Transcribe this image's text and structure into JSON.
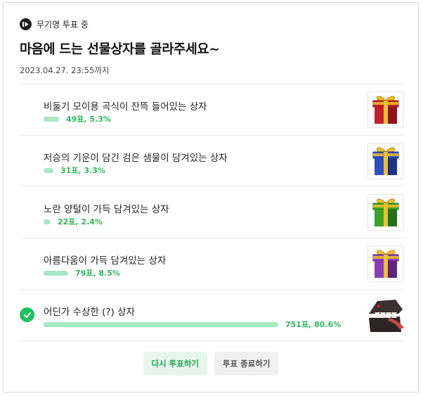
{
  "status": {
    "label": "무기명 투표 중"
  },
  "title": "마음에 드는 선물상자를 골라주세요~",
  "deadline": "2023.04.27. 23:55까지",
  "options": [
    {
      "label": "비둘기 모이용 곡식이 잔뜩 들어있는 상자",
      "result": "49표, 5.3%",
      "percent": 5.3,
      "selected": false,
      "image": "red-gift-box",
      "box_color": "#c4202a",
      "box_dark": "#8f1219"
    },
    {
      "label": "저승의 기운이 담긴 검은 샘물이 담겨있는 상자",
      "result": "31표, 3.3%",
      "percent": 3.3,
      "selected": false,
      "image": "blue-gift-box",
      "box_color": "#2f4fbf",
      "box_dark": "#1d328a"
    },
    {
      "label": "노란 양털이 가득 담겨있는 상자",
      "result": "22표, 2.4%",
      "percent": 2.4,
      "selected": false,
      "image": "green-gift-box",
      "box_color": "#3aa32a",
      "box_dark": "#23701a"
    },
    {
      "label": "아름다움이 가득 담겨있는 상자",
      "result": "79표, 8.5%",
      "percent": 8.5,
      "selected": false,
      "image": "purple-gift-box",
      "box_color": "#8a3fb8",
      "box_dark": "#5e2383"
    },
    {
      "label": "어딘가 수상한 (?) 상자",
      "result": "751표, 80.6%",
      "percent": 80.6,
      "selected": true,
      "image": "mimic-chest-monster"
    }
  ],
  "buttons": {
    "revote": "다시 투표하기",
    "end": "투표 종료하기"
  },
  "colors": {
    "bar": "#a6e8c4",
    "result_text": "#2fb85f",
    "check": "#1fc15f",
    "ribbon": "#f0c02a"
  }
}
